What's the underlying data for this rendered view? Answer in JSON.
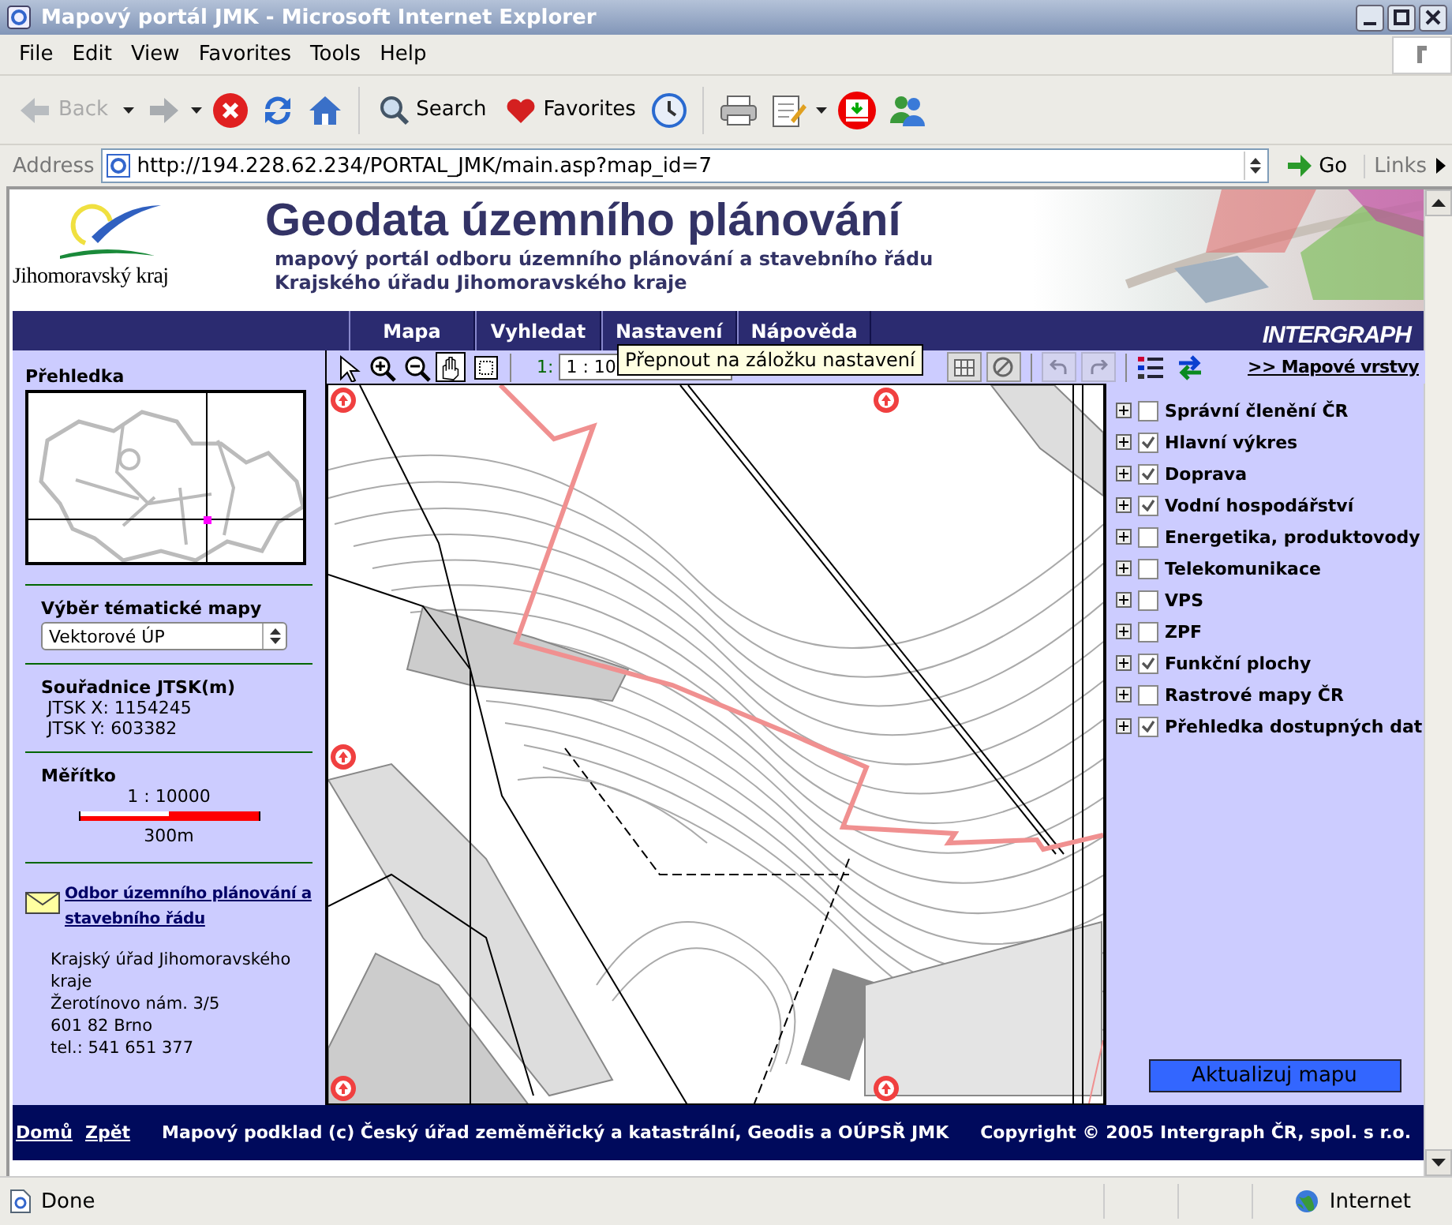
{
  "window": {
    "title": "Mapový portál JMK - Microsoft Internet Explorer"
  },
  "menu": [
    "File",
    "Edit",
    "View",
    "Favorites",
    "Tools",
    "Help"
  ],
  "toolbar": {
    "back": {
      "label": "Back",
      "disabled": true
    },
    "search": "Search",
    "favorites": "Favorites"
  },
  "address_bar": {
    "label": "Address",
    "url": "http://194.228.62.234/PORTAL_JMK/main.asp?map_id=7",
    "go": "Go",
    "links": "Links"
  },
  "banner": {
    "logo_text": "Jihomoravský kraj",
    "title": "Geodata územního plánování",
    "subtitle": [
      "mapový portál odboru územního plánování a stavebního řádu",
      "Krajského úřadu Jihomoravského kraje"
    ],
    "vendor_logo": "INTERGRAPH"
  },
  "nav_tabs": [
    "Mapa",
    "Vyhledat",
    "Nastavení",
    "Nápověda"
  ],
  "map_toolbar": {
    "tools": [
      {
        "selected": false
      },
      {
        "selected": false
      },
      {
        "selected": false
      },
      {
        "selected": true
      },
      {
        "selected": false
      }
    ],
    "scale_label": "1:",
    "scale_value": "1 : 10",
    "history": [
      {
        "disabled": true
      },
      {
        "disabled": true
      }
    ],
    "layers_link": ">> Mapové vrstvy",
    "tooltip": "Přepnout na záložku nastavení"
  },
  "left_panel": {
    "overview_heading": "Přehledka",
    "theme_heading": "Výběr tématické mapy",
    "theme_value": "Vektorové ÚP",
    "coords_heading": "Souřadnice JTSK(m)",
    "coord_x": "JTSK X: 1154245",
    "coord_y": "JTSK Y: 603382",
    "scale_heading": "Měřítko",
    "scale": "1 : 10000",
    "scale_bar_label": "300m",
    "contact_link": "Odbor územního plánování a stavebního řádu",
    "contact_lines": [
      "Krajský úřad Jihomoravského kraje",
      "Žerotínovo nám. 3/5",
      "601 82 Brno",
      "tel.: 541 651 377"
    ]
  },
  "layers": [
    {
      "label": "Správní členění ČR",
      "checked": false
    },
    {
      "label": "Hlavní výkres",
      "checked": true
    },
    {
      "label": "Doprava",
      "checked": true
    },
    {
      "label": "Vodní hospodářství",
      "checked": true
    },
    {
      "label": "Energetika, produktovody",
      "checked": false
    },
    {
      "label": "Telekomunikace",
      "checked": false
    },
    {
      "label": "VPS",
      "checked": false
    },
    {
      "label": "ZPF",
      "checked": false
    },
    {
      "label": "Funkční plochy",
      "checked": true
    },
    {
      "label": "Rastrové mapy ČR",
      "checked": false
    },
    {
      "label": "Přehledka dostupných dat",
      "checked": true
    }
  ],
  "update_button": "Aktualizuj mapu",
  "footer": {
    "links": [
      "Domů",
      "Zpět"
    ],
    "credit": "Mapový podklad (c) Český úřad zeměměřický a katastrální, Geodis a OÚPSŘ JMK",
    "copyright": "Copyright © 2005 Intergraph ČR, spol. s r.o."
  },
  "status_bar": {
    "text": "Done",
    "zone": "Internet"
  }
}
